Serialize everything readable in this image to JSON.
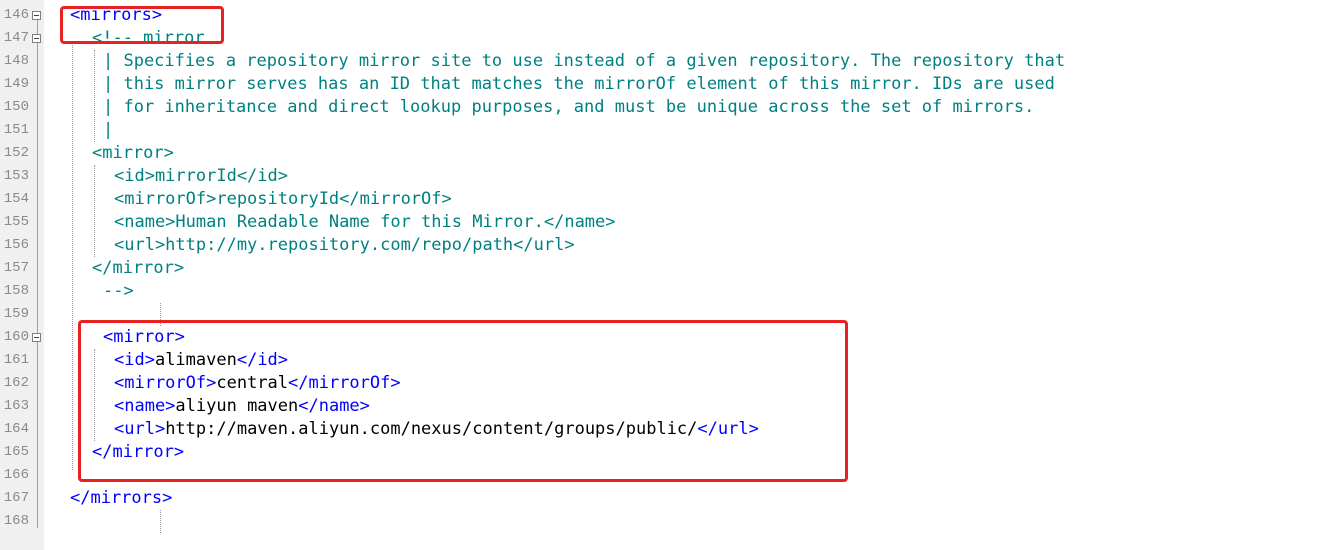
{
  "editor": {
    "line_numbers": [
      "146",
      "147",
      "148",
      "149",
      "150",
      "151",
      "152",
      "153",
      "154",
      "155",
      "156",
      "157",
      "158",
      "159",
      "160",
      "161",
      "162",
      "163",
      "164",
      "165",
      "166",
      "167",
      "168"
    ],
    "lines": {
      "l146": "<mirrors>",
      "l147": "<!-- mirror",
      "l148": "| Specifies a repository mirror site to use instead of a given repository. The repository that",
      "l149": "| this mirror serves has an ID that matches the mirrorOf element of this mirror. IDs are used",
      "l150": "| for inheritance and direct lookup purposes, and must be unique across the set of mirrors.",
      "l151": "|",
      "l152": "<mirror>",
      "l153": "<id>mirrorId</id>",
      "l154": "<mirrorOf>repositoryId</mirrorOf>",
      "l155": "<name>Human Readable Name for this Mirror.</name>",
      "l156": "<url>http://my.repository.com/repo/path</url>",
      "l157": "</mirror>",
      "l158": "-->",
      "l160": "<mirror>",
      "l161_open": "<id>",
      "l161_val": "alimaven",
      "l161_close": "</id>",
      "l162_open": "<mirrorOf>",
      "l162_val": "central",
      "l162_close": "</mirrorOf>",
      "l163_open": "<name>",
      "l163_val": "aliyun maven",
      "l163_close": "</name>",
      "l164_open": "<url>",
      "l164_val": "http://maven.aliyun.com/nexus/content/groups/public/",
      "l164_close": "</url>",
      "l165": "</mirror>",
      "l167": "</mirrors>"
    },
    "colors": {
      "tag": "#0000ff",
      "comment": "#008080",
      "text": "#000000",
      "annotation": "#e8231f"
    }
  }
}
